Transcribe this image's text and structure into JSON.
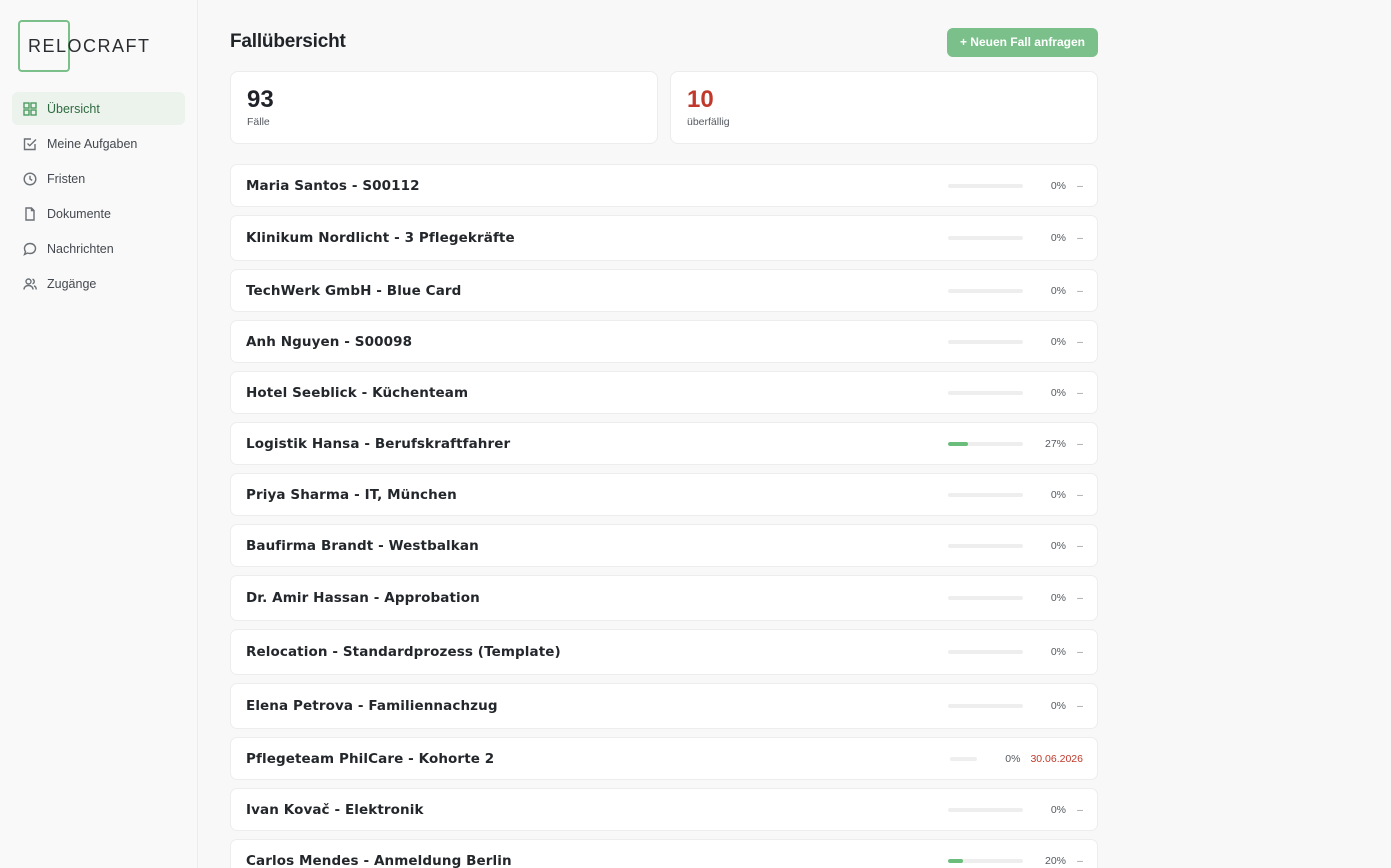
{
  "app": {
    "logo_part1": "RELO",
    "logo_part2": "CRAFT"
  },
  "sidebar": {
    "items": [
      {
        "label": "Übersicht",
        "icon": "grid-icon",
        "active": true
      },
      {
        "label": "Meine Aufgaben",
        "icon": "checkbox-icon",
        "active": false
      },
      {
        "label": "Fristen",
        "icon": "clock-icon",
        "active": false
      },
      {
        "label": "Dokumente",
        "icon": "file-icon",
        "active": false
      },
      {
        "label": "Nachrichten",
        "icon": "chat-icon",
        "active": false
      },
      {
        "label": "Zugänge",
        "icon": "users-icon",
        "active": false
      }
    ]
  },
  "header": {
    "title": "Fallübersicht",
    "new_case_label": "+ Neuen Fall anfragen"
  },
  "stats": [
    {
      "value": "93",
      "label": "Fälle",
      "color": "#1f2329"
    },
    {
      "value": "10",
      "label": "überfällig",
      "color": "#c0392b"
    }
  ],
  "colors": {
    "accent": "#7bc08a",
    "progress_fill": "#6bbd7c",
    "overdue": "#c0392b"
  },
  "cases": [
    {
      "name": "Maria Santos - S00112",
      "progress": 0,
      "pct": "0%",
      "due": "–",
      "overdue": false
    },
    {
      "name": "Klinikum Nordlicht - 3 Pflegekräfte",
      "progress": 0,
      "pct": "0%",
      "due": "–",
      "overdue": false
    },
    {
      "name": "TechWerk GmbH - Blue Card",
      "progress": 0,
      "pct": "0%",
      "due": "–",
      "overdue": false
    },
    {
      "name": "Anh Nguyen - S00098",
      "progress": 0,
      "pct": "0%",
      "due": "–",
      "overdue": false
    },
    {
      "name": "Hotel Seeblick - Küchenteam",
      "progress": 0,
      "pct": "0%",
      "due": "–",
      "overdue": false
    },
    {
      "name": "Logistik Hansa - Berufskraftfahrer",
      "progress": 27,
      "pct": "27%",
      "due": "–",
      "overdue": false
    },
    {
      "name": "Priya Sharma - IT, München",
      "progress": 0,
      "pct": "0%",
      "due": "–",
      "overdue": false
    },
    {
      "name": "Baufirma Brandt - Westbalkan",
      "progress": 0,
      "pct": "0%",
      "due": "–",
      "overdue": false
    },
    {
      "name": "Dr. Amir Hassan - Approbation",
      "progress": 0,
      "pct": "0%",
      "due": "–",
      "overdue": false
    },
    {
      "name": "Relocation - Standardprozess (Template)",
      "progress": 0,
      "pct": "0%",
      "due": "–",
      "overdue": false
    },
    {
      "name": "Elena Petrova - Familiennachzug",
      "progress": 0,
      "pct": "0%",
      "due": "–",
      "overdue": false
    },
    {
      "name": "Pflegeteam PhilCare - Kohorte 2",
      "progress": 0,
      "pct": "0%",
      "due": "30.06.2026",
      "overdue": true
    },
    {
      "name": "Ivan Kovač - Elektronik",
      "progress": 0,
      "pct": "0%",
      "due": "–",
      "overdue": false
    },
    {
      "name": "Carlos Mendes - Anmeldung Berlin",
      "progress": 20,
      "pct": "20%",
      "due": "–",
      "overdue": false
    }
  ]
}
